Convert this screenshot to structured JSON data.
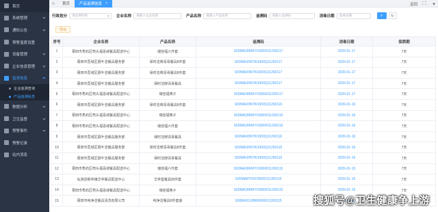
{
  "sidebar": {
    "items": [
      {
        "label": "首页",
        "icon": "home-icon",
        "kind": "home"
      },
      {
        "label": "系统管理",
        "icon": "settings-icon",
        "kind": "parent"
      },
      {
        "label": "通知公告",
        "icon": "notice-icon",
        "kind": "parent"
      },
      {
        "label": "预警温度设置",
        "icon": "thermometer-icon",
        "kind": "plain"
      },
      {
        "label": "设备管理",
        "icon": "device-icon",
        "kind": "parent"
      },
      {
        "label": "企业信息管理",
        "icon": "building-icon",
        "kind": "parent"
      },
      {
        "label": "监测信息",
        "icon": "monitor-icon",
        "kind": "active-parent"
      },
      {
        "label": "企业追溯查询",
        "kind": "sub"
      },
      {
        "label": "产品追溯信息",
        "kind": "sub-active"
      },
      {
        "label": "数据分析",
        "icon": "chart-icon",
        "kind": "parent"
      },
      {
        "label": "卫生监督",
        "icon": "shield-icon",
        "kind": "parent"
      },
      {
        "label": "预警事件",
        "icon": "alert-icon",
        "kind": "parent"
      },
      {
        "label": "预警记录",
        "icon": "record-icon",
        "kind": "plain"
      },
      {
        "label": "站内消息",
        "icon": "message-icon",
        "kind": "plain"
      }
    ]
  },
  "topbar": {
    "collapse_icon": "«",
    "tabs": [
      {
        "label": "首页",
        "active": false
      },
      {
        "label": "产品追溯信息",
        "active": true,
        "close": "×"
      }
    ],
    "right": {
      "back_label": "返回",
      "fullscreen_icon": "⛶",
      "avatar_label": "▾"
    }
  },
  "filters": {
    "region_label": "行政划分",
    "region_placeholder": "请选择机构",
    "company_label": "企业名称",
    "company_placeholder": "请输入企业名称",
    "product_label": "产品名称",
    "product_placeholder": "请输入产品名称",
    "trace_label": "追溯码",
    "trace_placeholder": "请输入追溯码",
    "date_label": "消毒日期",
    "date_placeholder": "选择日期",
    "search_icon": "⌕",
    "reset_icon": "↻"
  },
  "toolbar": {
    "export_label": "导出"
  },
  "table": {
    "columns": [
      "序号",
      "企业名称",
      "产品名称",
      "追溯码",
      "消毒日期",
      "保质期"
    ],
    "rows": [
      [
        "1",
        "莆田市秀屿区笏头福喜城餐具配送中心",
        "瑞佳福六件套",
        "S00MA30RMYX9000011260117",
        "2026-01-17",
        "7天"
      ],
      [
        "2",
        "莆田市荔城区振叶洁餐具服务部",
        "保时洁牌清毒餐具8件套",
        "S00MA30N7W1900Q11260117",
        "2026-01-17",
        "7天"
      ],
      [
        "3",
        "莆田市荔城区振叶洁餐具服务部",
        "保时洁牌清毒餐具8件套",
        "S00MA30N7W1900Q11260117",
        "2026-01-17",
        "7天"
      ],
      [
        "4",
        "莆田市荔城区振叶洁餐具服务部",
        "保时洁牌清毒餐具",
        "S00MA30N7W1900Q11260117",
        "2026-01-17",
        "7天"
      ],
      [
        "5",
        "莆田市秀屿区笏头福喜城餐具配送中心",
        "瑞佳福筷子",
        "S00MA30RMYX9000011260117",
        "2026-01-17",
        "7天"
      ],
      [
        "6",
        "莆田市荔城区振叶洁餐具服务部",
        "保时洁牌清毒餐具8件套",
        "S00MA30N7W1900Q11260116",
        "2026-01-16",
        "7天"
      ],
      [
        "7",
        "莆田市秀屿区笏头福喜城餐具配送中心",
        "瑞佳福筷子",
        "S00MA30RMYX9000011260116",
        "2026-01-16",
        "7天"
      ],
      [
        "8",
        "莆田市秀屿区笏头福喜城餐具配送中心",
        "瑞佳福六件套",
        "S00MA30RMYX9000011260116",
        "2026-01-16",
        "7天"
      ],
      [
        "9",
        "莆田市荔城区振叶洁餐具服务部",
        "保时洁牌清毒餐具",
        "S00MA30N7W1900Q11260116",
        "2026-01-16",
        "7天"
      ],
      [
        "10",
        "莆田市荔城区振叶洁餐具服务部",
        "保时洁牌清毒餐具8件套",
        "S00MA30N7W1900Q11260116",
        "2026-01-16",
        "7天"
      ],
      [
        "11",
        "莆田市荔城区振叶洁餐具服务部",
        "保时洁牌清毒餐具",
        "S00MA30N7W1900Q11260115",
        "2026-01-15",
        "7天"
      ],
      [
        "12",
        "莆田市秀屿区笏头福喜城餐具配送中心",
        "瑞佳福六件套",
        "S00MA30RMYX9000011260115",
        "2026-01-15",
        "7天"
      ],
      [
        "13",
        "仙游县枫亭镇华亭餐具配送中心",
        "华亭堡餐具四件套",
        "S00MA8T6XF0500D11260115",
        "2026-01-15",
        "7天"
      ],
      [
        "14",
        "莆田市秀屿区笏头福喜城餐具配送中心",
        "瑞佳福筷子",
        "S00MA30RMYX9000011260115",
        "2026-01-15",
        "7天"
      ],
      [
        "15",
        "莆田市纯净洁餐具清洗有限公司",
        "纯净洁餐具8件套装",
        "S00MA31U8RN000011260115",
        "2026-01-15",
        "7天"
      ]
    ]
  },
  "watermark": "搜狐号@卫生健康争上游",
  "colors": {
    "accent": "#3f9eff",
    "sidebar_bg": "#2b3445",
    "warning": "#e6a23c"
  }
}
